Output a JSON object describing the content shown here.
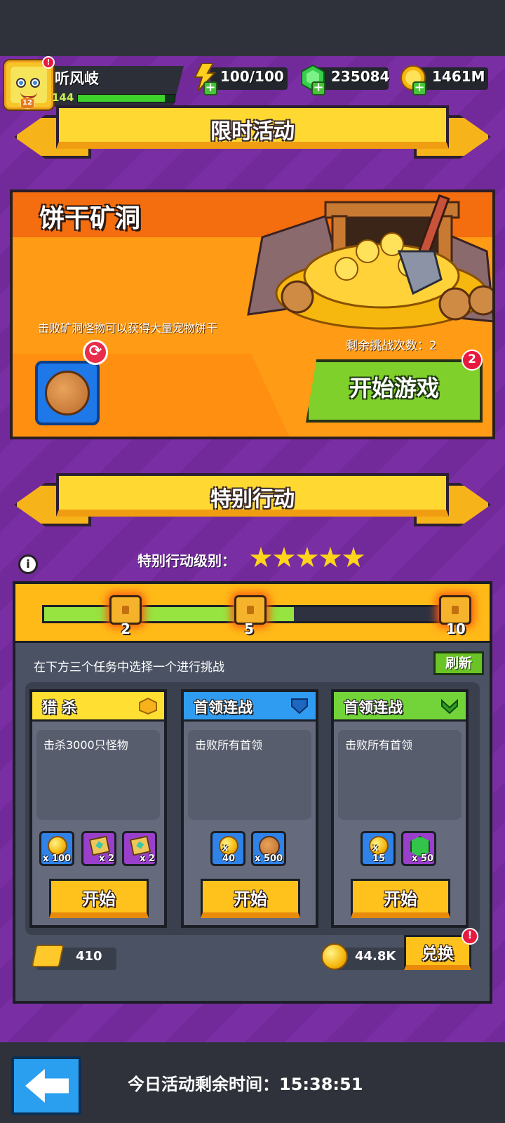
{
  "player": {
    "name": "听风岐",
    "level_badge": "12",
    "xp": "144",
    "xp_fraction": 0.9,
    "alert": "!"
  },
  "resources": {
    "energy": "100/100",
    "gems": "235084",
    "coins": "1461M"
  },
  "limited_event": {
    "banner_title": "限时活动",
    "title": "饼干矿洞",
    "description": "击败矿洞怪物可以获得大量宠物饼干",
    "remaining": "剩余挑战次数：2",
    "start_button": "开始游戏",
    "start_badge": "2"
  },
  "special_op": {
    "banner_title": "特别行动",
    "info_icon": "i",
    "rank_label": "特别行动级别：",
    "stars": 5,
    "progress_fraction": 0.6,
    "milestones": [
      "2",
      "5",
      "10"
    ],
    "instruction": "在下方三个任务中选择一个进行挑战",
    "refresh_button": "刷新",
    "tasks": [
      {
        "name": "猎 杀",
        "header_color": "#ffe032",
        "description": "击杀3000只怪物",
        "rewards": [
          {
            "icon": "coin-icon",
            "qty": "x 100"
          },
          {
            "icon": "skill-book-icon",
            "qty": "x 2"
          },
          {
            "icon": "skill-book-icon",
            "qty": "x 2"
          }
        ],
        "start": "开始"
      },
      {
        "name": "首领连战",
        "header_color": "#2f9cf2",
        "description": "击败所有首领",
        "rewards": [
          {
            "icon": "coin-icon",
            "qty": "x 40"
          },
          {
            "icon": "cookie-icon",
            "qty": "x 500"
          }
        ],
        "start": "开始"
      },
      {
        "name": "首领连战",
        "header_color": "#73d43a",
        "description": "击败所有首领",
        "rewards": [
          {
            "icon": "coin-icon",
            "qty": "x 15"
          },
          {
            "icon": "gem-icon",
            "qty": "x 50"
          }
        ],
        "start": "开始"
      }
    ],
    "tickets": "410",
    "exchange_coins": "44.8K",
    "exchange_button": "兑换",
    "exchange_alert": "!"
  },
  "footer": {
    "time_label": "今日活动剩余时间：15:38:51"
  }
}
